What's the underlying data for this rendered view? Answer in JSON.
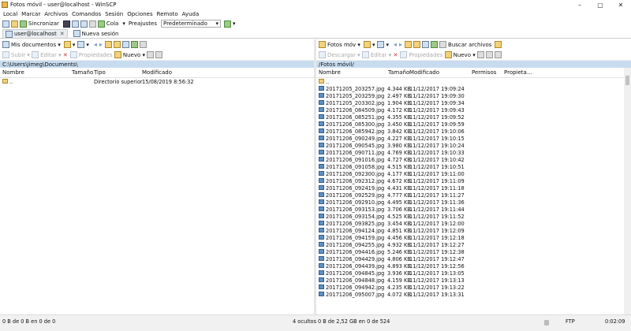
{
  "window": {
    "title": "Fotos móvil - user@localhost - WinSCP",
    "minimize": "–",
    "maximize": "▢",
    "close": "✕"
  },
  "menu": [
    "Local",
    "Marcar",
    "Archivos",
    "Comandos",
    "Sesión",
    "Opciones",
    "Remoto",
    "Ayuda"
  ],
  "toolbar": {
    "sync": "Sincronizar",
    "queue": "Cola",
    "presets_label": "Preajustes",
    "preset_value": "Predeterminado"
  },
  "tabs": {
    "session": "user@localhost",
    "new_session": "Nueva sesión"
  },
  "left": {
    "location": "Mis documentos",
    "upload": "Subir",
    "edit": "Editar",
    "properties": "Propiedades",
    "new": "Nuevo",
    "path": "C:\\Users\\jimeg\\Documents\\",
    "columns": [
      "Nombre",
      "Tamaño",
      "Tipo",
      "Modificado"
    ],
    "rows": [
      {
        "name": "..",
        "size": "",
        "type": "Directorio superior",
        "modified": "15/08/2019  8:56:32"
      }
    ]
  },
  "right": {
    "location": "Fotos móv",
    "download": "Descargar",
    "edit": "Editar",
    "properties": "Propiedades",
    "new": "Nuevo",
    "find": "Buscar archivos",
    "path": "/Fotos móvil/",
    "columns": [
      "Nombre",
      "Tamaño",
      "Modificado",
      "Permisos",
      "Propieta..."
    ],
    "parent": "..",
    "files": [
      {
        "name": "20171205_203257.jpg",
        "size": "4.344 KB",
        "modified": "11/12/2017 19:09:24"
      },
      {
        "name": "20171205_203259.jpg",
        "size": "2.497 KB",
        "modified": "11/12/2017 19:09:30"
      },
      {
        "name": "20171205_203302.jpg",
        "size": "1.904 KB",
        "modified": "11/12/2017 19:09:34"
      },
      {
        "name": "20171206_084509.jpg",
        "size": "4.172 KB",
        "modified": "11/12/2017 19:09:43"
      },
      {
        "name": "20171206_085251.jpg",
        "size": "4.355 KB",
        "modified": "11/12/2017 19:09:52"
      },
      {
        "name": "20171206_085300.jpg",
        "size": "3.450 KB",
        "modified": "11/12/2017 19:09:59"
      },
      {
        "name": "20171206_085942.jpg",
        "size": "3.842 KB",
        "modified": "11/12/2017 19:10:06"
      },
      {
        "name": "20171206_090249.jpg",
        "size": "4.227 KB",
        "modified": "11/12/2017 19:10:15"
      },
      {
        "name": "20171206_090545.jpg",
        "size": "3.980 KB",
        "modified": "11/12/2017 19:10:24"
      },
      {
        "name": "20171206_090711.jpg",
        "size": "4.769 KB",
        "modified": "11/12/2017 19:10:33"
      },
      {
        "name": "20171206_091016.jpg",
        "size": "4.727 KB",
        "modified": "11/12/2017 19:10:42"
      },
      {
        "name": "20171206_091058.jpg",
        "size": "4.515 KB",
        "modified": "11/12/2017 19:10:51"
      },
      {
        "name": "20171206_092300.jpg",
        "size": "4.177 KB",
        "modified": "11/12/2017 19:11:00"
      },
      {
        "name": "20171206_092312.jpg",
        "size": "4.672 KB",
        "modified": "11/12/2017 19:11:09"
      },
      {
        "name": "20171206_092419.jpg",
        "size": "4.431 KB",
        "modified": "11/12/2017 19:11:18"
      },
      {
        "name": "20171206_092529.jpg",
        "size": "4.777 KB",
        "modified": "11/12/2017 19:11:27"
      },
      {
        "name": "20171206_092910.jpg",
        "size": "4.495 KB",
        "modified": "11/12/2017 19:11:36"
      },
      {
        "name": "20171206_093153.jpg",
        "size": "3.706 KB",
        "modified": "11/12/2017 19:11:44"
      },
      {
        "name": "20171206_093154.jpg",
        "size": "4.525 KB",
        "modified": "11/12/2017 19:11:52"
      },
      {
        "name": "20171206_093825.jpg",
        "size": "3.454 KB",
        "modified": "11/12/2017 19:12:00"
      },
      {
        "name": "20171206_094124.jpg",
        "size": "4.851 KB",
        "modified": "11/12/2017 19:12:09"
      },
      {
        "name": "20171206_094159.jpg",
        "size": "4.456 KB",
        "modified": "11/12/2017 19:12:18"
      },
      {
        "name": "20171206_094255.jpg",
        "size": "4.932 KB",
        "modified": "11/12/2017 19:12:27"
      },
      {
        "name": "20171206_094416.jpg",
        "size": "5.246 KB",
        "modified": "11/12/2017 19:12:38"
      },
      {
        "name": "20171206_094429.jpg",
        "size": "4.806 KB",
        "modified": "11/12/2017 19:12:47"
      },
      {
        "name": "20171206_094439.jpg",
        "size": "4.893 KB",
        "modified": "11/12/2017 19:12:56"
      },
      {
        "name": "20171206_094845.jpg",
        "size": "3.936 KB",
        "modified": "11/12/2017 19:13:05"
      },
      {
        "name": "20171206_094848.jpg",
        "size": "4.159 KB",
        "modified": "11/12/2017 19:13:13"
      },
      {
        "name": "20171206_094942.jpg",
        "size": "4.235 KB",
        "modified": "11/12/2017 19:13:22"
      },
      {
        "name": "20171206_095007.jpg",
        "size": "4.072 KB",
        "modified": "11/12/2017 19:13:31"
      }
    ]
  },
  "status": {
    "left": "0 B de 0 B en 0 de 0",
    "hidden": "4 ocultos",
    "right": "0 B de 2,52 GB en 0 de 524",
    "protocol": "FTP",
    "time": "0:02:09"
  }
}
